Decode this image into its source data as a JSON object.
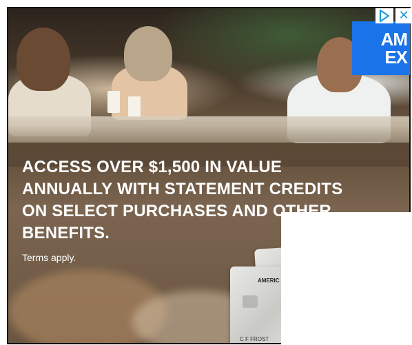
{
  "ad": {
    "headline_lines": [
      "ACCESS OVER $1,500 IN VALUE",
      "ANNUALLY WITH STATEMENT CREDITS",
      "ON SELECT PURCHASES AND OTHER",
      "BENEFITS."
    ],
    "terms": "Terms apply.",
    "logo": {
      "line1": "AM",
      "line2": "EX",
      "color": "#1a73e8"
    },
    "card": {
      "brand": "AMERIC",
      "holder": "C F FROST"
    },
    "controls": {
      "adchoices_icon": "adchoices-triangle-icon",
      "close_icon": "close-icon",
      "accent": "#1a9bd6"
    }
  }
}
